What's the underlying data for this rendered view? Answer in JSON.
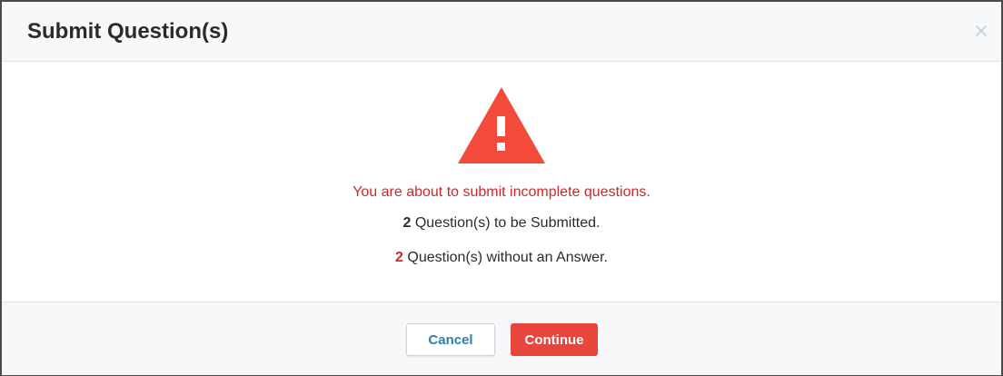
{
  "modal": {
    "title": "Submit Question(s)",
    "close_label": "×"
  },
  "body": {
    "warning_message": "You are about to submit incomplete questions.",
    "submitted_count": "2",
    "submitted_text": " Question(s) to be Submitted.",
    "unanswered_count": "2",
    "unanswered_text": " Question(s) without an Answer."
  },
  "footer": {
    "cancel_label": "Cancel",
    "continue_label": "Continue"
  },
  "colors": {
    "accent_red": "#e8453c",
    "warning_text": "#d0262b",
    "cancel_text": "#2f7fa8",
    "header_bg": "#f7f8fa"
  },
  "icons": {
    "warning": "warning-triangle-icon",
    "close": "close-icon"
  }
}
